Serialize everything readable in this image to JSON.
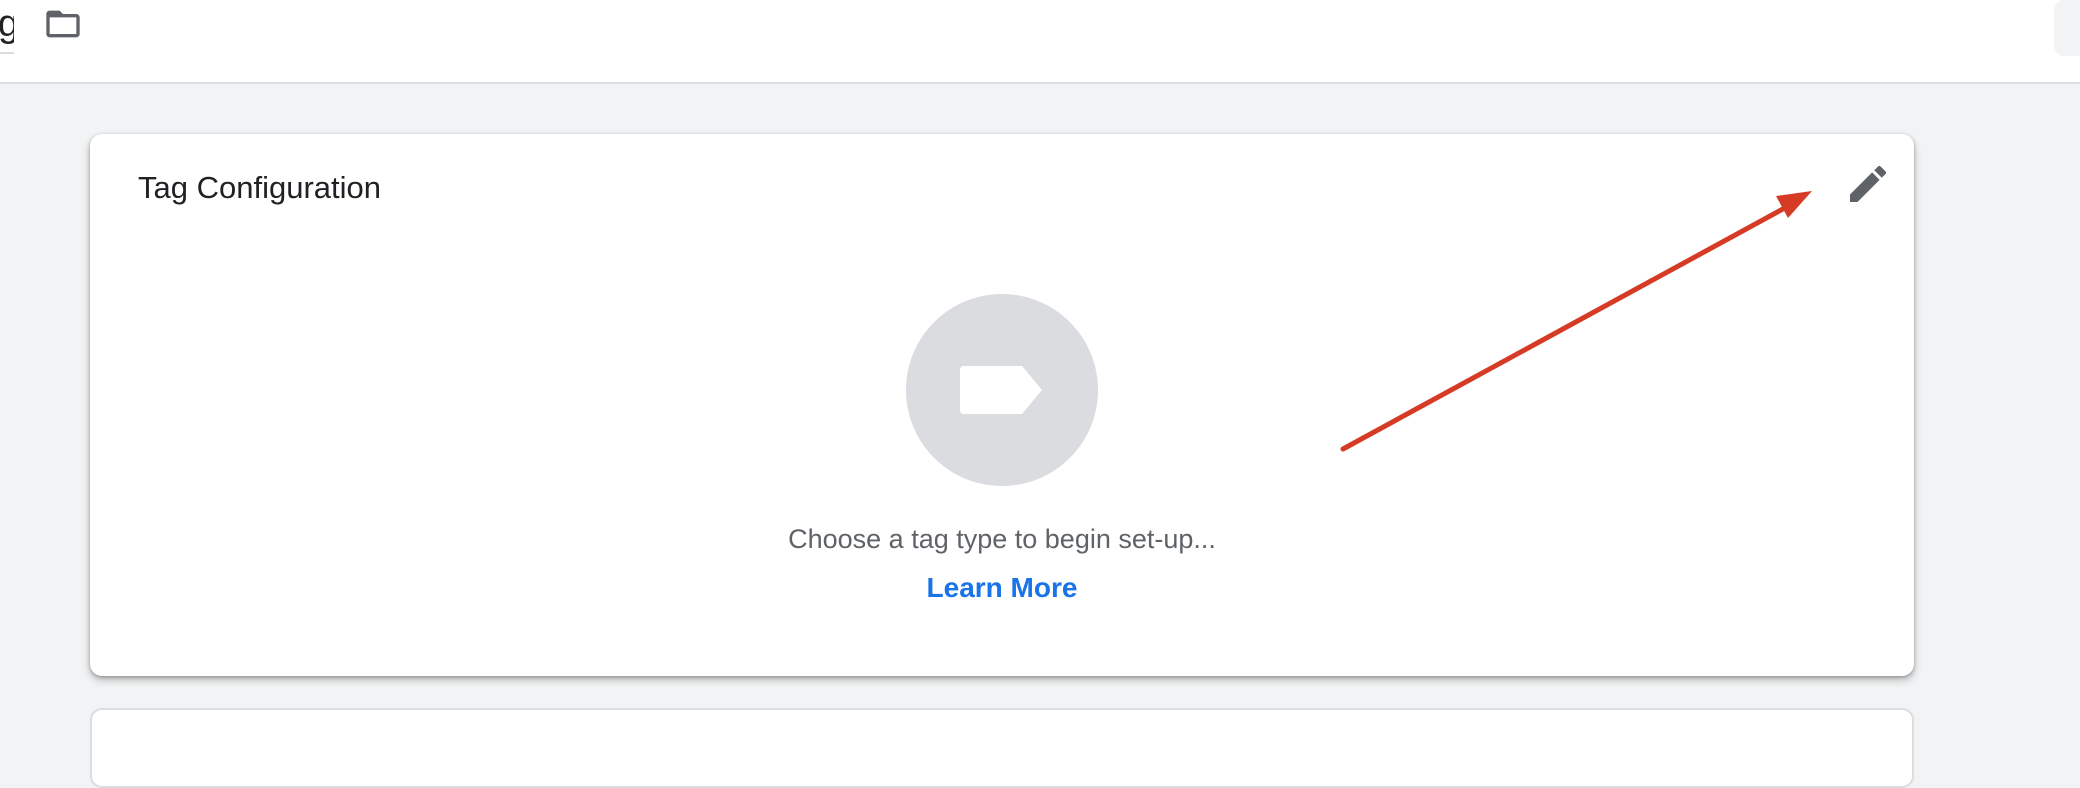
{
  "header": {
    "name_fragment": "g",
    "folder_icon": "folder-icon"
  },
  "tag_configuration": {
    "title": "Tag Configuration",
    "edit_icon": "pencil-icon",
    "placeholder_icon": "tag-icon",
    "empty_text": "Choose a tag type to begin set-up...",
    "learn_more": "Learn More"
  },
  "colors": {
    "background": "#f1f3f4",
    "card": "#ffffff",
    "icon_gray": "#5f6368",
    "placeholder_circle": "#dadce0",
    "link_blue": "#1a73e8",
    "annotation_arrow": "#d63b25"
  }
}
